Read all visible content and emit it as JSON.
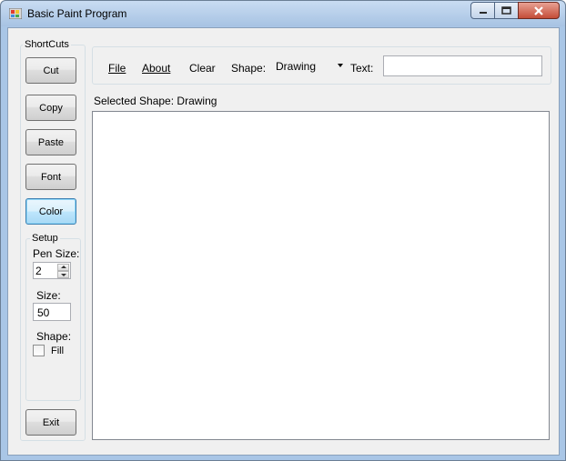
{
  "window": {
    "title": "Basic Paint Program"
  },
  "shortcuts": {
    "title": "ShortCuts",
    "cut": "Cut",
    "copy": "Copy",
    "paste": "Paste",
    "font": "Font",
    "color": "Color",
    "exit": "Exit"
  },
  "setup": {
    "title": "Setup",
    "pen_size_label": "Pen Size:",
    "pen_size_value": "2",
    "size_label": "Size:",
    "size_value": "50",
    "shape_label": "Shape:",
    "fill_label": "Fill",
    "fill_checked": false
  },
  "menu": {
    "file": "File",
    "about": "About",
    "clear": "Clear",
    "shape_label": "Shape:",
    "shape_selected": "Drawing",
    "text_label": "Text:",
    "text_value": ""
  },
  "status": {
    "selected_shape": "Selected Shape: Drawing"
  },
  "colors": {
    "accent": "#3c7fb1",
    "titlebar": "#a7c3e3",
    "client_bg": "#f0f0f0"
  },
  "icons": {
    "app": "app-icon",
    "minimize": "minimize-icon",
    "maximize": "maximize-icon",
    "close": "close-icon",
    "dropdown": "chevron-down-icon"
  }
}
